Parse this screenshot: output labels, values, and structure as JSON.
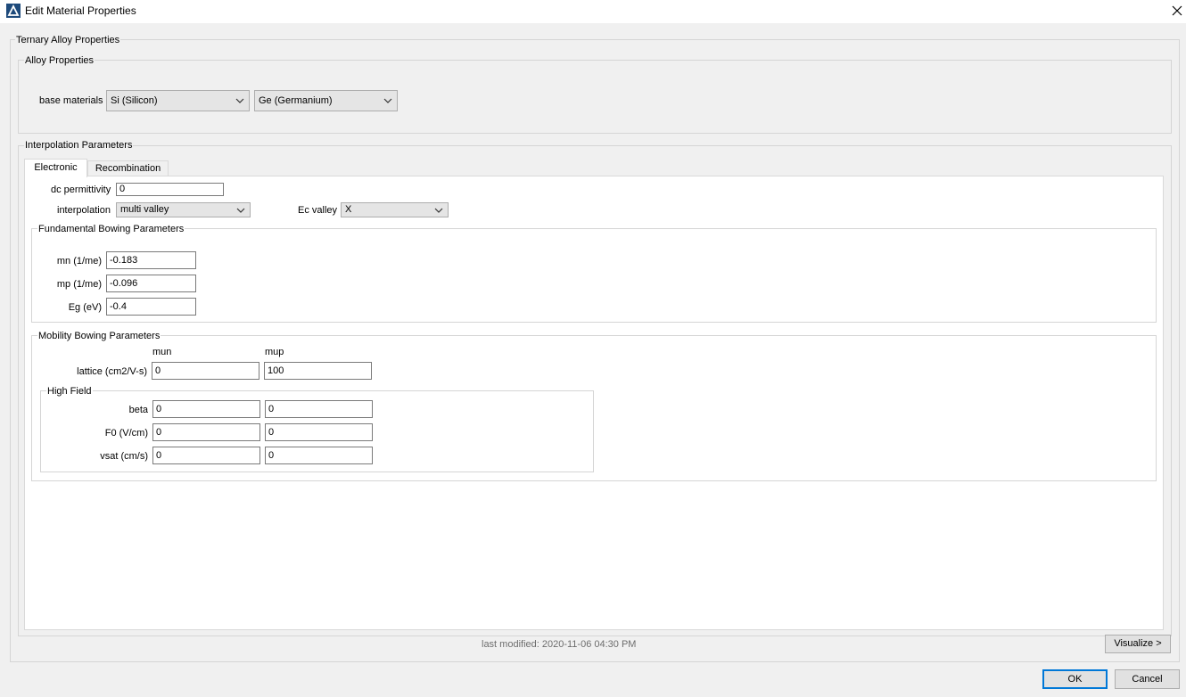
{
  "window": {
    "title": "Edit Material Properties",
    "icons": {
      "app": "app-delta-icon",
      "close": "close-icon"
    }
  },
  "ternary": {
    "legend": "Ternary Alloy Properties",
    "alloy": {
      "legend": "Alloy Properties",
      "base_materials_label": "base materials",
      "material1": "Si (Silicon)",
      "material2": "Ge (Germanium)"
    },
    "interp": {
      "legend": "Interpolation Parameters",
      "tabs": [
        {
          "label": "Electronic",
          "active": true
        },
        {
          "label": "Recombination",
          "active": false
        }
      ],
      "dc_permittivity_label": "dc permittivity",
      "dc_permittivity": "0",
      "interpolation_label": "interpolation",
      "interpolation": "multi valley",
      "ec_valley_label": "Ec valley",
      "ec_valley": "X",
      "fundamental": {
        "legend": "Fundamental Bowing Parameters",
        "rows": [
          {
            "label": "mn (1/me)",
            "value": "-0.183"
          },
          {
            "label": "mp (1/me)",
            "value": "-0.096"
          },
          {
            "label": "Eg (eV)",
            "value": "-0.4"
          }
        ]
      },
      "mobility": {
        "legend": "Mobility Bowing Parameters",
        "col_mun": "mun",
        "col_mup": "mup",
        "lattice_label": "lattice (cm2/V-s)",
        "lattice_mun": "0",
        "lattice_mup": "100",
        "high_field": {
          "legend": "High Field",
          "rows": [
            {
              "label": "beta",
              "mun": "0",
              "mup": "0"
            },
            {
              "label": "F0 (V/cm)",
              "mun": "0",
              "mup": "0"
            },
            {
              "label": "vsat (cm/s)",
              "mun": "0",
              "mup": "0"
            }
          ]
        }
      }
    }
  },
  "footer": {
    "last_modified": "last modified: 2020-11-06 04:30 PM",
    "visualize": "Visualize >",
    "ok": "OK",
    "cancel": "Cancel"
  },
  "colors": {
    "accent": "#0078d7",
    "window_bg": "#f0f0f0",
    "panel_bg": "#ffffff"
  }
}
